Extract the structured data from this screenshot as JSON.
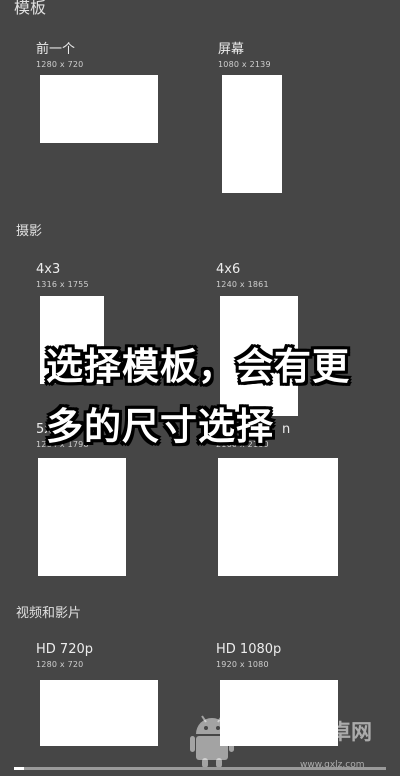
{
  "sections": {
    "templates": "模板",
    "photo": "摄影",
    "video": "视频和影片"
  },
  "templates": {
    "previous": {
      "name": "前一个",
      "size": "1280 x 720"
    },
    "screen": {
      "name": "屏幕",
      "size": "1080 x 2139"
    },
    "p4x3": {
      "name": "4x3",
      "size": "1316 x 1755"
    },
    "p4x6": {
      "name": "4x6",
      "size": "1240 x 1861"
    },
    "p5x7": {
      "name": "5x",
      "size": "1284 x 1798"
    },
    "square": {
      "name": "n",
      "size": "2160 x 2160"
    },
    "hd720": {
      "name": "HD 720p",
      "size": "1280 x 720"
    },
    "hd1080": {
      "name": "HD 1080p",
      "size": "1920 x 1080"
    }
  },
  "overlay": {
    "line1": "选择模板，会有更",
    "line2": "多的尺寸选择"
  },
  "watermark": {
    "text": "卓网",
    "url": "www.qxlz.com"
  },
  "colors": {
    "background": "#464646",
    "thumbnail": "#ffffff"
  }
}
